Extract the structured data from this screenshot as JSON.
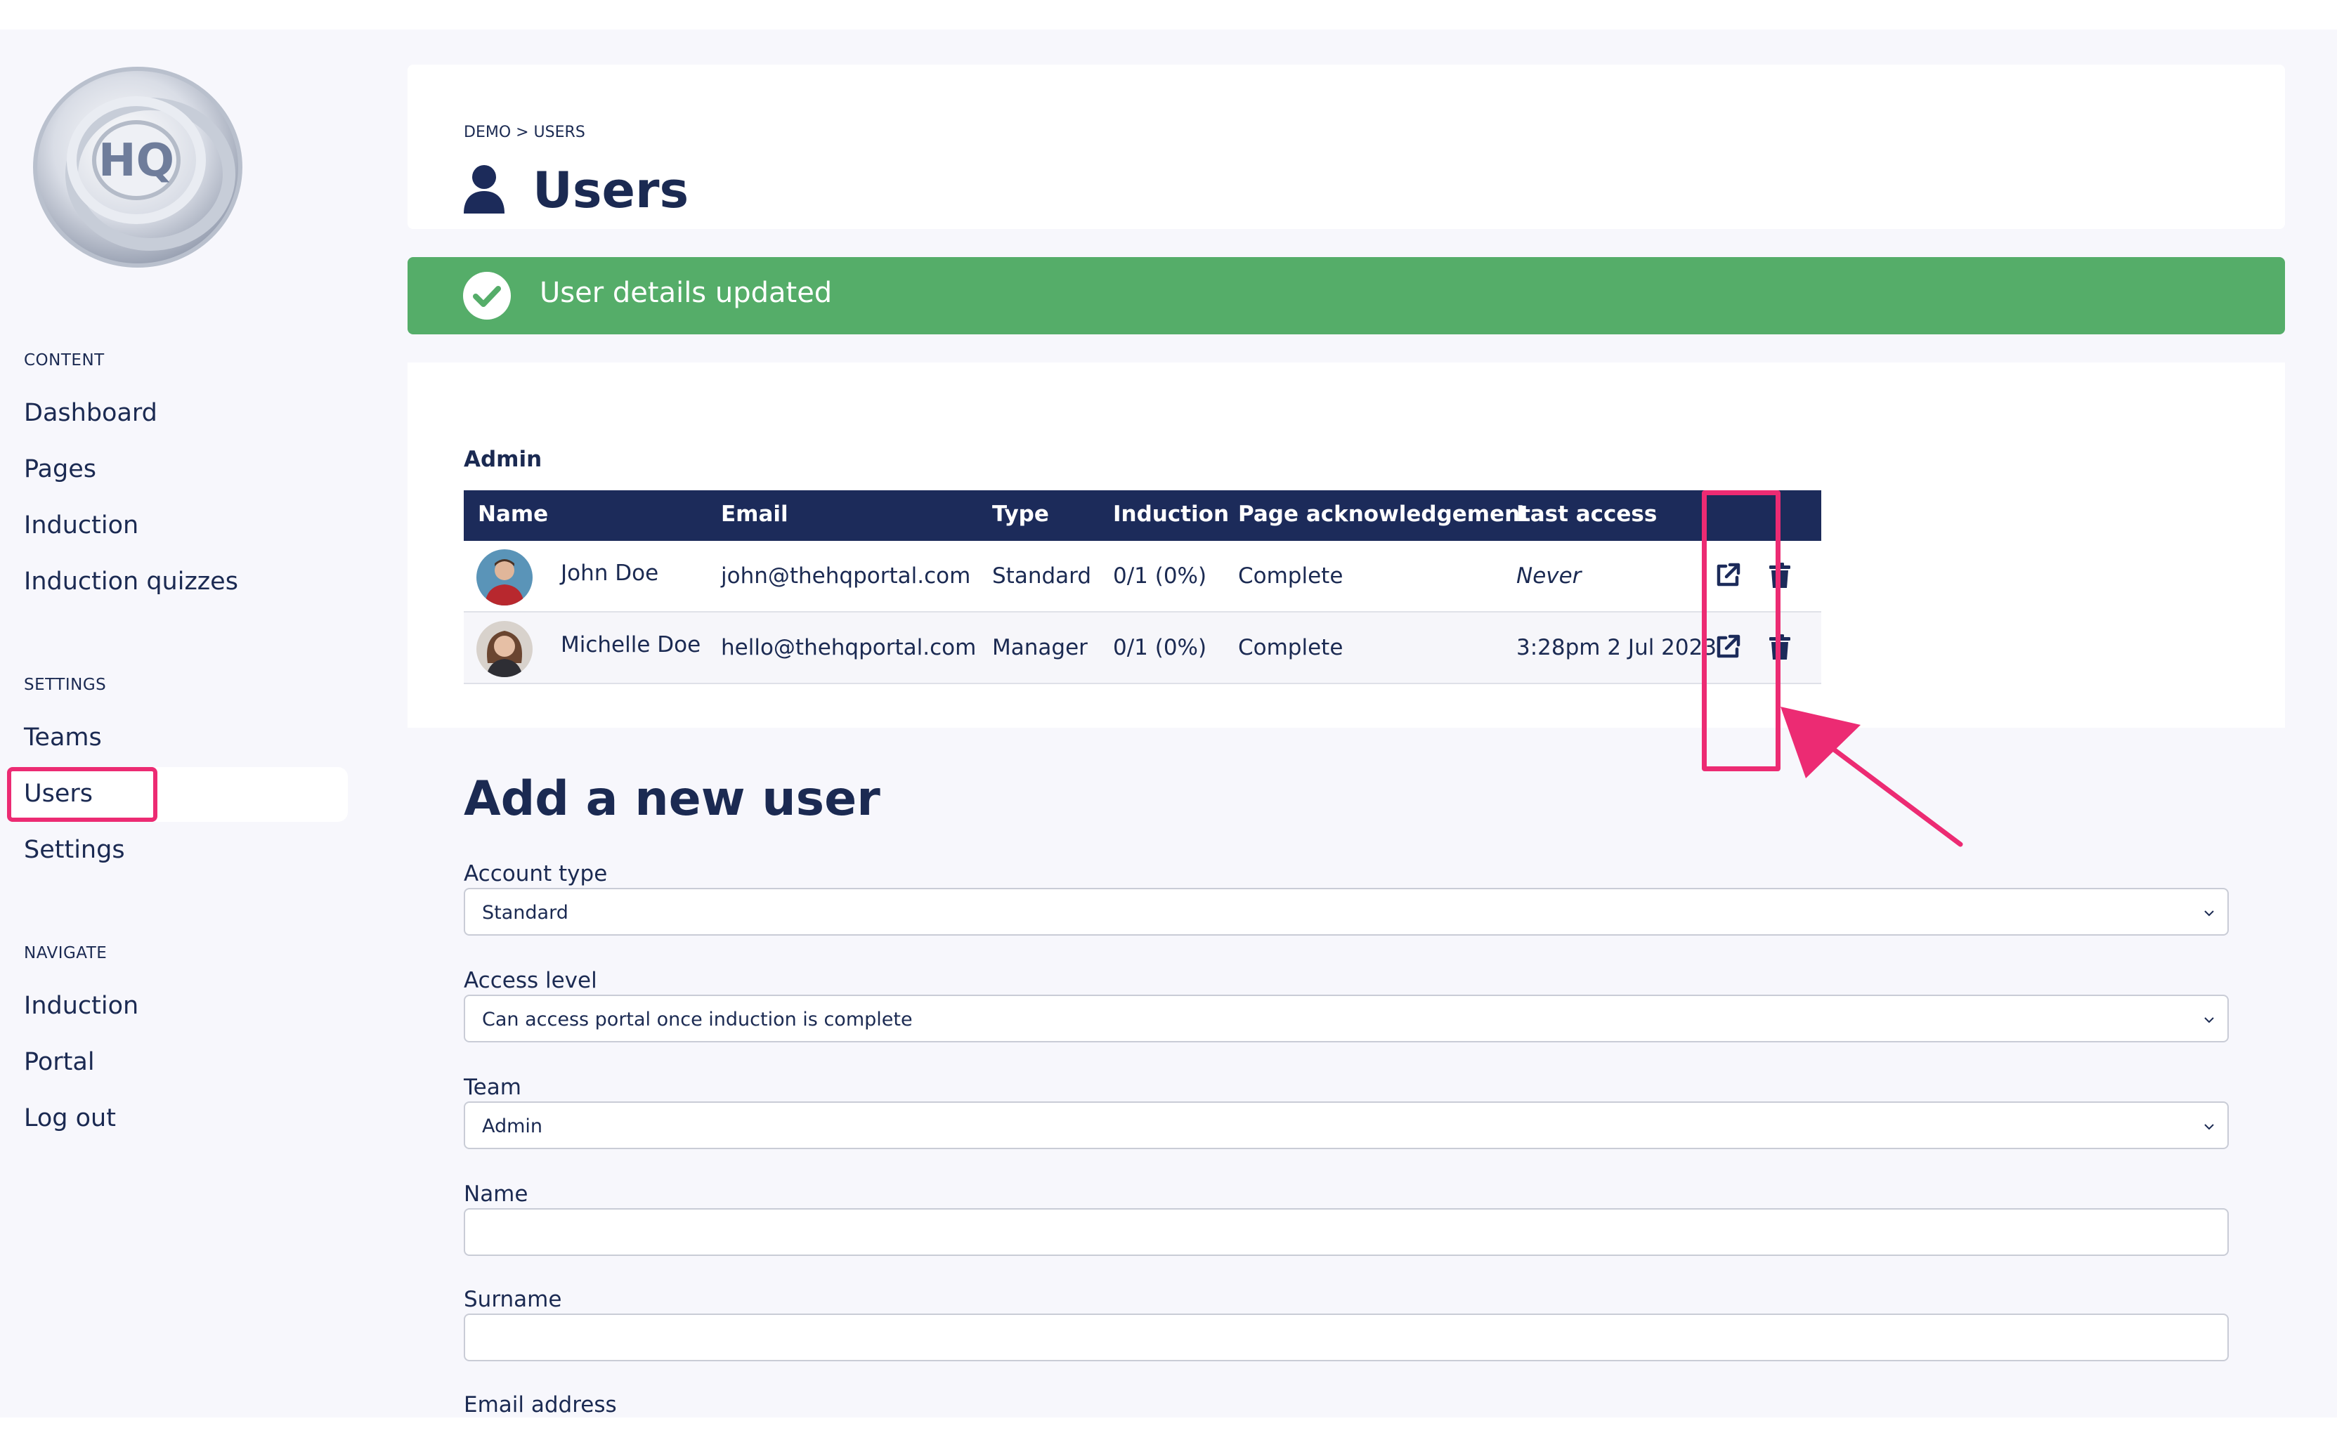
{
  "sidebar": {
    "logo": {
      "text": "HQ"
    },
    "sections": {
      "content": {
        "label": "CONTENT",
        "items": [
          "Dashboard",
          "Pages",
          "Induction",
          "Induction quizzes"
        ]
      },
      "settings": {
        "label": "SETTINGS",
        "items": [
          "Teams",
          "Users",
          "Settings"
        ],
        "active": "Users"
      },
      "navigate": {
        "label": "NAVIGATE",
        "items": [
          "Induction",
          "Portal",
          "Log out"
        ]
      }
    }
  },
  "header": {
    "breadcrumb": "DEMO > USERS",
    "title": "Users",
    "icon": "user-icon"
  },
  "alert": {
    "message": "User details updated",
    "icon": "check-circle-icon",
    "color": "#55ad69"
  },
  "users_table": {
    "team": "Admin",
    "columns": [
      "Name",
      "Email",
      "Type",
      "Induction",
      "Page acknowledgement",
      "Last access"
    ],
    "rows": [
      {
        "name": "John Doe",
        "email": "john@thehqportal.com",
        "type": "Standard",
        "induction": "0/1 (0%)",
        "acknowledgement": "Complete",
        "last_access": "Never"
      },
      {
        "name": "Michelle Doe",
        "email": "hello@thehqportal.com",
        "type": "Manager",
        "induction": "0/1 (0%)",
        "acknowledgement": "Complete",
        "last_access": "3:28pm 2 Jul 2023"
      }
    ],
    "actions": [
      "external-link-icon",
      "trash-icon"
    ]
  },
  "form": {
    "title": "Add a new user",
    "fields": {
      "account_type": {
        "label": "Account type",
        "value": "Standard"
      },
      "access_level": {
        "label": "Access level",
        "value": "Can access portal once induction is complete"
      },
      "team": {
        "label": "Team",
        "value": "Admin"
      },
      "name": {
        "label": "Name",
        "value": ""
      },
      "surname": {
        "label": "Surname",
        "value": ""
      },
      "email": {
        "label": "Email address"
      }
    }
  },
  "colors": {
    "primary": "#1c2b5a",
    "success": "#55ad69",
    "annotation": "#ec2b73",
    "background": "#f7f7fc"
  }
}
